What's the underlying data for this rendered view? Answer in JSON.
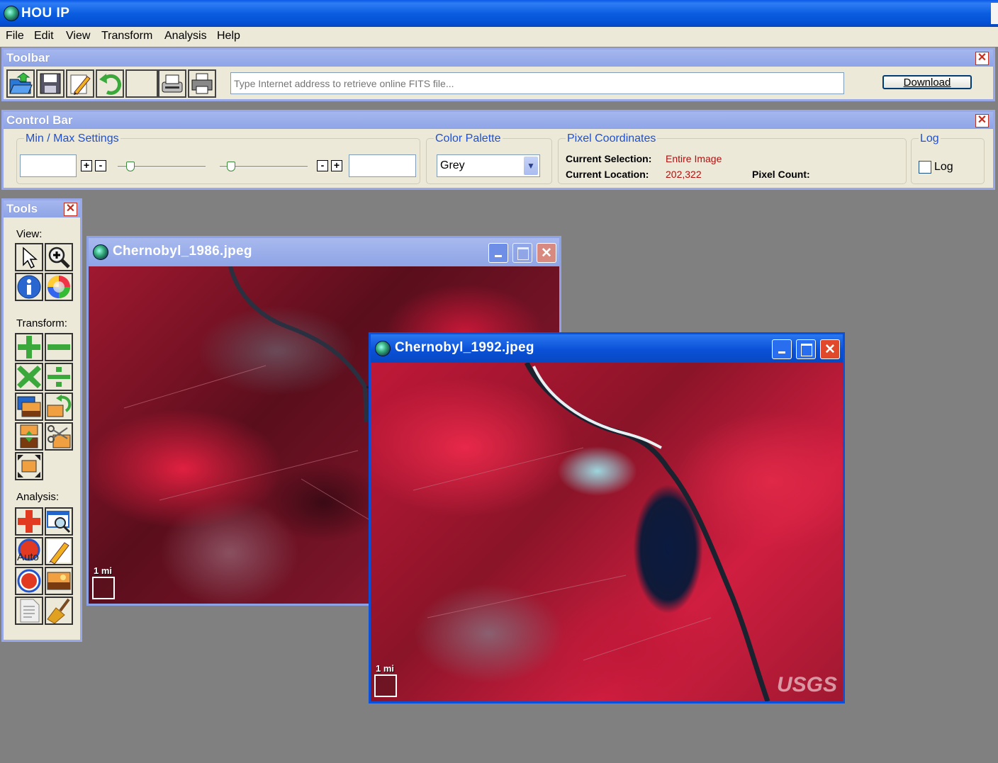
{
  "app": {
    "title": "HOU IP"
  },
  "menu": [
    "File",
    "Edit",
    "View",
    "Transform",
    "Analysis",
    "Help"
  ],
  "toolbar": {
    "title": "Toolbar",
    "close": "✕",
    "url_placeholder": "Type Internet address to retrieve online FITS file...",
    "download_label": "Download",
    "buttons": [
      "open-icon",
      "save-icon",
      "edit-icon",
      "undo-icon",
      "blank",
      "scanner-icon",
      "print-icon"
    ]
  },
  "control_bar": {
    "title": "Control Bar",
    "close": "✕",
    "minmax_title": "Min / Max Settings",
    "plus": "+",
    "minus": "-",
    "palette_title": "Color Palette",
    "palette_value": "Grey",
    "pixel_title": "Pixel Coordinates",
    "current_selection_label": "Current Selection:",
    "current_selection_value": "Entire Image",
    "current_location_label": "Current Location:",
    "current_location_value": "202,322",
    "pixel_count_label": "Pixel Count:",
    "log_title": "Log",
    "log_checkbox_label": "Log",
    "log_checked": false
  },
  "tools": {
    "title": "Tools",
    "close": "✕",
    "view_label": "View:",
    "transform_label": "Transform:",
    "analysis_label": "Analysis:",
    "auto_label": "Auto"
  },
  "windows": [
    {
      "title": "Chernobyl_1986.jpeg",
      "scale": "1 mi"
    },
    {
      "title": "Chernobyl_1992.jpeg",
      "scale": "1 mi",
      "watermark": "USGS"
    }
  ],
  "colors": {
    "titlebar": "#0450d6",
    "panel_bg": "#ece9d8",
    "panel_title": "#98a8e8",
    "group_title": "#2050d0",
    "value_red": "#b01010",
    "desktop": "#808080"
  }
}
